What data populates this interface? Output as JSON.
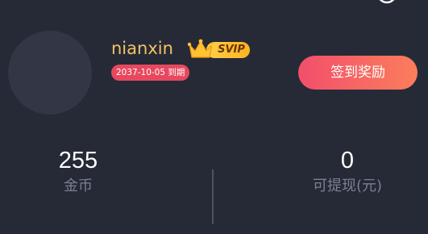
{
  "top_bar": {
    "icons": [
      "message-icon",
      "settings-icon"
    ]
  },
  "profile": {
    "username": "nianxin",
    "badge_label": "SVIP",
    "expiry_text": "2037-10-05 到期",
    "checkin_label": "签到奖励"
  },
  "stats": {
    "coins_value": "255",
    "coins_label": "金币",
    "cash_value": "0",
    "cash_label": "可提现(元)"
  },
  "colors": {
    "background": "#262a37",
    "username": "#f3c366",
    "accent_start": "#f24f6b",
    "accent_end": "#fb7d5c",
    "svip_gold": "#ffc232",
    "expiry_tag": "#e8485f"
  }
}
